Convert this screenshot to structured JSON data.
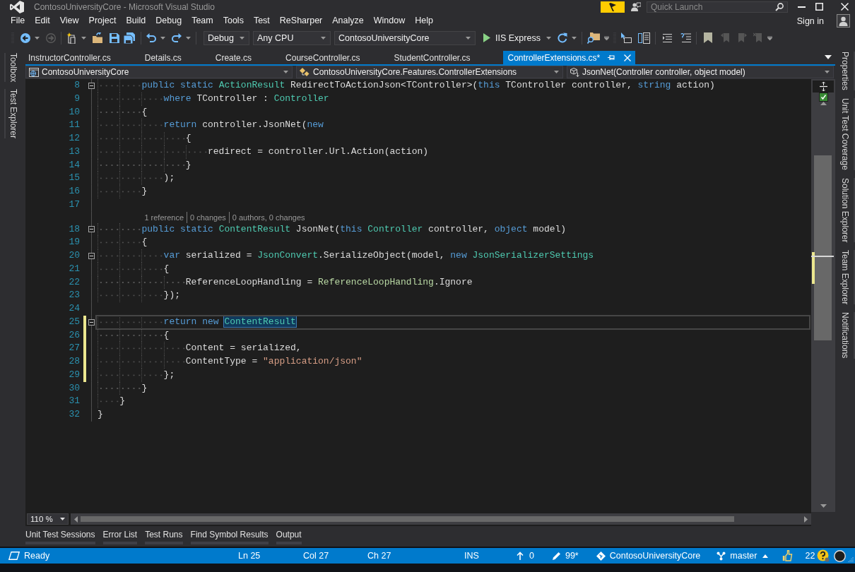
{
  "window": {
    "title": "ContosoUniversityCore - Microsoft Visual Studio",
    "quick_launch": {
      "placeholder": "Quick Launch"
    }
  },
  "menu": [
    "File",
    "Edit",
    "View",
    "Project",
    "Build",
    "Debug",
    "Team",
    "Tools",
    "Test",
    "ReSharper",
    "Analyze",
    "Window",
    "Help"
  ],
  "account": {
    "label": "Sign in"
  },
  "toolbar": {
    "configuration": "Debug",
    "platform": "Any CPU",
    "startup_project": "ContosoUniversityCore",
    "run_target": "IIS Express"
  },
  "left_tool_tabs": [
    "Toolbox",
    "Test Explorer"
  ],
  "tabs": [
    {
      "label": "InstructorController.cs",
      "selected": false
    },
    {
      "label": "Details.cs",
      "selected": false
    },
    {
      "label": "Create.cs",
      "selected": false
    },
    {
      "label": "CourseController.cs",
      "selected": false
    },
    {
      "label": "StudentController.cs",
      "selected": false
    },
    {
      "label": "ControllerExtensions.cs*",
      "selected": true
    }
  ],
  "navigation_bar": {
    "project": "ContosoUniversityCore",
    "type": "ContosoUniversityCore.Features.ControllerExtensions",
    "member": "JsonNet(Controller controller, object model)"
  },
  "editor": {
    "lines": [
      {
        "number": "8",
        "fold": true,
        "modified": false,
        "current": false,
        "tokens": [
          {
            "kind": "keyword",
            "text": "        public static "
          },
          {
            "kind": "type",
            "text": "ActionResult"
          },
          {
            "kind": "plain",
            "text": " RedirectToActionJson<TController>("
          },
          {
            "kind": "keyword",
            "text": "this"
          },
          {
            "kind": "plain",
            "text": " TController controller, "
          },
          {
            "kind": "keyword",
            "text": "string"
          },
          {
            "kind": "plain",
            "text": " action)"
          }
        ]
      },
      {
        "number": "9",
        "fold": false,
        "modified": false,
        "current": false,
        "tokens": [
          {
            "kind": "keyword",
            "text": "            where"
          },
          {
            "kind": "plain",
            "text": " TController : "
          },
          {
            "kind": "type",
            "text": "Controller"
          }
        ]
      },
      {
        "number": "10",
        "fold": false,
        "modified": false,
        "current": false,
        "tokens": [
          {
            "kind": "plain",
            "text": "        {"
          }
        ]
      },
      {
        "number": "11",
        "fold": false,
        "modified": false,
        "current": false,
        "tokens": [
          {
            "kind": "keyword",
            "text": "            return"
          },
          {
            "kind": "plain",
            "text": " controller.JsonNet("
          },
          {
            "kind": "keyword",
            "text": "new"
          }
        ]
      },
      {
        "number": "12",
        "fold": false,
        "modified": false,
        "current": false,
        "tokens": [
          {
            "kind": "plain",
            "text": "                {"
          }
        ]
      },
      {
        "number": "13",
        "fold": false,
        "modified": false,
        "current": false,
        "tokens": [
          {
            "kind": "plain",
            "text": "                    redirect = controller.Url.Action(action)"
          }
        ]
      },
      {
        "number": "14",
        "fold": false,
        "modified": false,
        "current": false,
        "tokens": [
          {
            "kind": "plain",
            "text": "                }"
          }
        ]
      },
      {
        "number": "15",
        "fold": false,
        "modified": false,
        "current": false,
        "tokens": [
          {
            "kind": "plain",
            "text": "            );"
          }
        ]
      },
      {
        "number": "16",
        "fold": false,
        "modified": false,
        "current": false,
        "tokens": [
          {
            "kind": "plain",
            "text": "        }"
          }
        ]
      },
      {
        "number": "17",
        "fold": false,
        "modified": false,
        "current": false
      },
      {
        "number": "18",
        "fold": true,
        "modified": false,
        "current": false,
        "codelens": [
          "1 reference",
          "0 changes",
          "0 authors, 0 changes"
        ],
        "tokens": [
          {
            "kind": "keyword",
            "text": "        public static "
          },
          {
            "kind": "type",
            "text": "ContentResult"
          },
          {
            "kind": "plain",
            "text": " JsonNet("
          },
          {
            "kind": "keyword",
            "text": "this "
          },
          {
            "kind": "type",
            "text": "Controller"
          },
          {
            "kind": "plain",
            "text": " controller, "
          },
          {
            "kind": "keyword",
            "text": "object"
          },
          {
            "kind": "plain",
            "text": " model)"
          }
        ]
      },
      {
        "number": "19",
        "fold": false,
        "modified": false,
        "current": false,
        "tokens": [
          {
            "kind": "plain",
            "text": "        {"
          }
        ]
      },
      {
        "number": "20",
        "fold": true,
        "modified": false,
        "current": false,
        "tokens": [
          {
            "kind": "keyword",
            "text": "            var"
          },
          {
            "kind": "plain",
            "text": " serialized = "
          },
          {
            "kind": "type",
            "text": "JsonConvert"
          },
          {
            "kind": "plain",
            "text": ".SerializeObject(model, "
          },
          {
            "kind": "keyword",
            "text": "new "
          },
          {
            "kind": "type",
            "text": "JsonSerializerSettings"
          }
        ]
      },
      {
        "number": "21",
        "fold": false,
        "modified": false,
        "current": false,
        "tokens": [
          {
            "kind": "plain",
            "text": "            {"
          }
        ]
      },
      {
        "number": "22",
        "fold": false,
        "modified": false,
        "current": false,
        "tokens": [
          {
            "kind": "plain",
            "text": "                ReferenceLoopHandling = "
          },
          {
            "kind": "enum",
            "text": "ReferenceLoopHandling"
          },
          {
            "kind": "plain",
            "text": ".Ignore"
          }
        ]
      },
      {
        "number": "23",
        "fold": false,
        "modified": false,
        "current": false,
        "tokens": [
          {
            "kind": "plain",
            "text": "            });"
          }
        ]
      },
      {
        "number": "24",
        "fold": false,
        "modified": false,
        "current": false
      },
      {
        "number": "25",
        "fold": true,
        "modified": true,
        "current": true,
        "tokens": [
          {
            "kind": "keyword",
            "text": "            return new "
          },
          {
            "kind": "highlight",
            "text": "ContentResult"
          }
        ]
      },
      {
        "number": "26",
        "fold": false,
        "modified": true,
        "current": false,
        "tokens": [
          {
            "kind": "plain",
            "text": "            {"
          }
        ]
      },
      {
        "number": "27",
        "fold": false,
        "modified": true,
        "current": false,
        "tokens": [
          {
            "kind": "plain",
            "text": "                Content = serialized,"
          }
        ]
      },
      {
        "number": "28",
        "fold": false,
        "modified": true,
        "current": false,
        "tokens": [
          {
            "kind": "plain",
            "text": "                ContentType = "
          },
          {
            "kind": "string",
            "text": "\"application/json\""
          }
        ]
      },
      {
        "number": "29",
        "fold": false,
        "modified": true,
        "current": false,
        "tokens": [
          {
            "kind": "plain",
            "text": "            };"
          }
        ]
      },
      {
        "number": "30",
        "fold": false,
        "modified": false,
        "current": false,
        "tokens": [
          {
            "kind": "plain",
            "text": "        }"
          }
        ]
      },
      {
        "number": "31",
        "fold": false,
        "modified": false,
        "current": false,
        "tokens": [
          {
            "kind": "plain",
            "text": "    }"
          }
        ]
      },
      {
        "number": "32",
        "fold": false,
        "modified": false,
        "current": false,
        "tokens": [
          {
            "kind": "plain",
            "text": "}"
          }
        ]
      }
    ],
    "zoom": "110 %"
  },
  "right_tool_tabs": [
    "Properties",
    "Unit Test Coverage",
    "Solution Explorer",
    "Team Explorer",
    "Notifications"
  ],
  "bottom_tabs": [
    "Unit Test Sessions",
    "Error List",
    "Test Runs",
    "Find Symbol Results",
    "Output"
  ],
  "status_bar": {
    "state": "Ready",
    "line": "Ln 25",
    "column": "Col 27",
    "char": "Ch 27",
    "mode": "INS",
    "pushes": "0",
    "edits": "99*",
    "repository": "ContosoUniversityCore",
    "branch": "master",
    "notifications": "22"
  }
}
